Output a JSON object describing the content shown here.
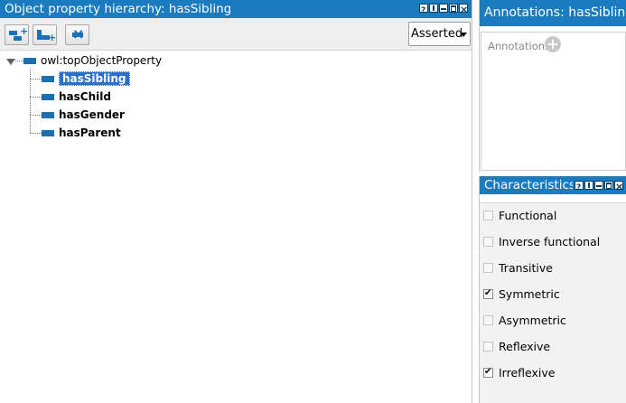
{
  "left_panel": {
    "title": "Object property hierarchy: hasSibling",
    "view_mode": "Asserted",
    "tree": {
      "root": "owl:topObjectProperty",
      "children": [
        "hasSibling",
        "hasChild",
        "hasGender",
        "hasParent"
      ],
      "selected": "hasSibling"
    }
  },
  "annotations_panel": {
    "title": "Annotations: hasSibling",
    "section_label": "Annotations"
  },
  "characteristics_panel": {
    "title": "Characteristics:",
    "items": [
      {
        "label": "Functional",
        "checked": false
      },
      {
        "label": "Inverse functional",
        "checked": false
      },
      {
        "label": "Transitive",
        "checked": false
      },
      {
        "label": "Symmetric",
        "checked": true
      },
      {
        "label": "Asymmetric",
        "checked": false
      },
      {
        "label": "Reflexive",
        "checked": false
      },
      {
        "label": "Irreflexive",
        "checked": true
      }
    ]
  },
  "colors": {
    "titlebar": "#1b7bbf",
    "selection": "#2a6fcc",
    "property_icon": "#1e6fb0"
  }
}
